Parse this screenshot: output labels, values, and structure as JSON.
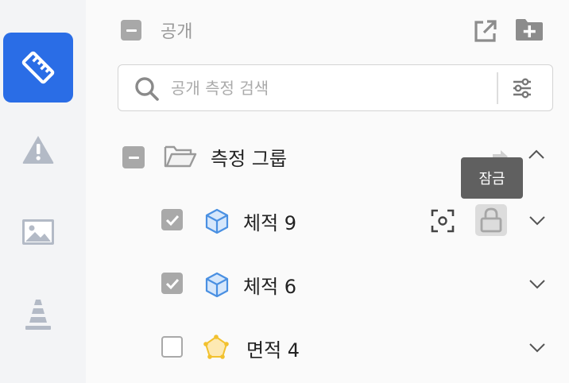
{
  "header": {
    "title": "공개"
  },
  "search": {
    "placeholder": "공개 측정 검색"
  },
  "group": {
    "title": "측정 그룹"
  },
  "tooltip": {
    "text": "잠금"
  },
  "items": [
    {
      "label": "체적 9",
      "checked": true,
      "icon": "cube-icon"
    },
    {
      "label": "체적 6",
      "checked": true,
      "icon": "cube-icon"
    },
    {
      "label": "면적 4",
      "checked": false,
      "icon": "polygon-icon"
    }
  ],
  "colors": {
    "accent": "#2a6de6",
    "cube": "#4a90e2",
    "polygon": "#f2c12e"
  }
}
